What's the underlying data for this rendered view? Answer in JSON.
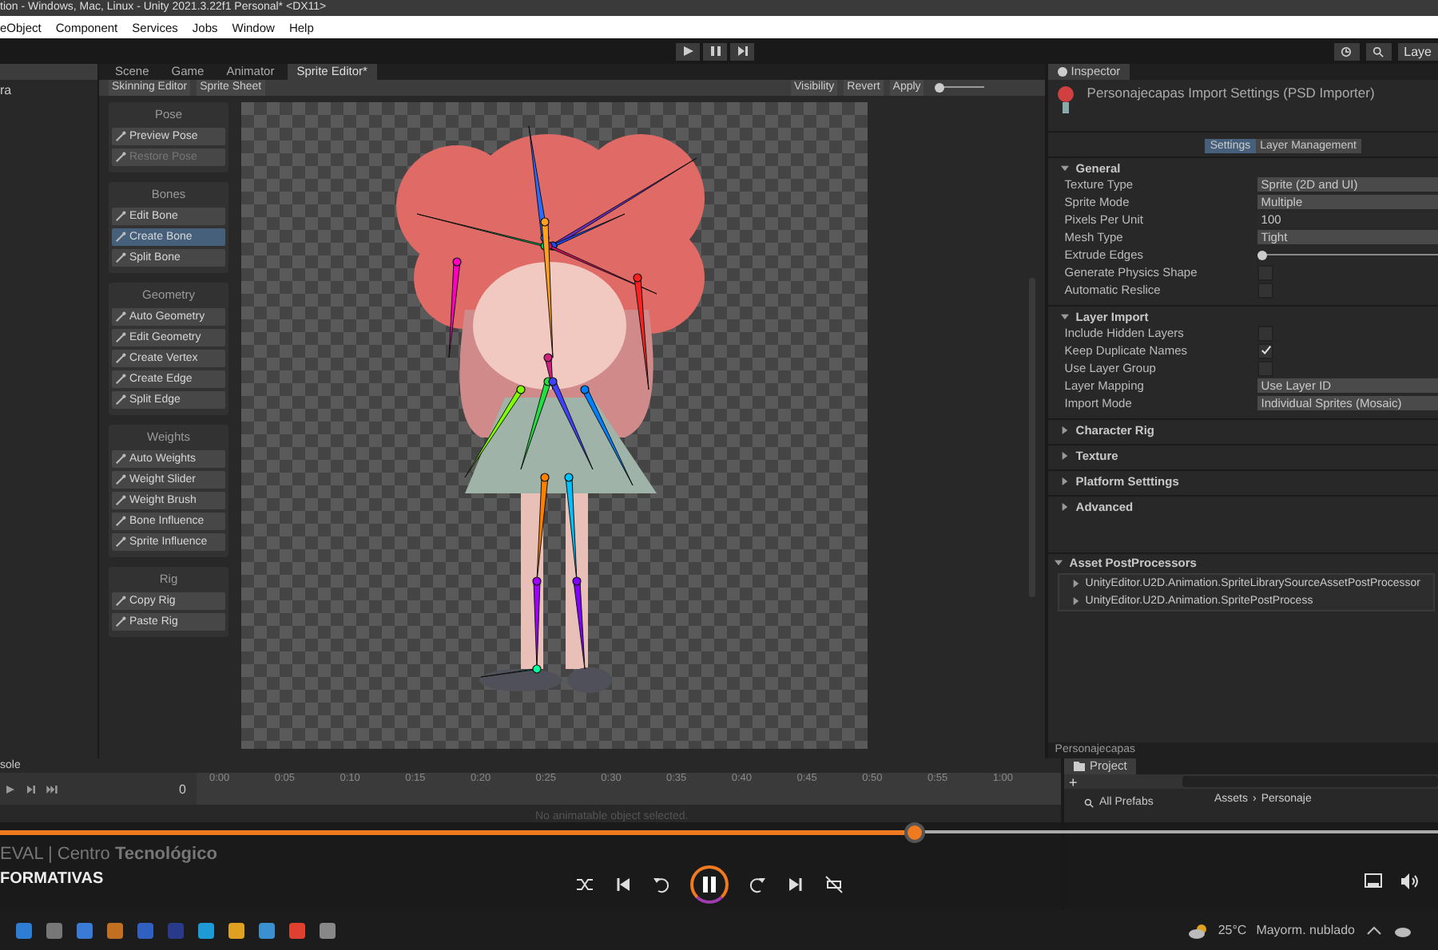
{
  "window": {
    "title": "tion - Windows, Mac, Linux - Unity 2021.3.22f1 Personal* <DX11>"
  },
  "menu": [
    "eObject",
    "Component",
    "Services",
    "Jobs",
    "Window",
    "Help"
  ],
  "toolbar": {
    "layers_label": "Laye"
  },
  "hierarchy": {
    "items": [
      {
        "label": "ra",
        "selected": false
      }
    ]
  },
  "editor_tabs": [
    {
      "label": "Scene",
      "selected": false
    },
    {
      "label": "Game",
      "selected": false
    },
    {
      "label": "Animator",
      "selected": false
    },
    {
      "label": "Sprite Editor*",
      "selected": true
    }
  ],
  "sprite_toolbar": {
    "mode": "Skinning Editor",
    "sheet": "Sprite Sheet",
    "buttons": [
      "Visibility",
      "Revert",
      "Apply"
    ],
    "zoom": {
      "level": 0.05
    }
  },
  "tool_groups": [
    {
      "title": "Pose",
      "tools": [
        {
          "label": "Preview Pose",
          "selected": false,
          "disabled": false
        },
        {
          "label": "Restore Pose",
          "selected": false,
          "disabled": true
        }
      ]
    },
    {
      "title": "Bones",
      "tools": [
        {
          "label": "Edit Bone",
          "selected": false,
          "disabled": false
        },
        {
          "label": "Create Bone",
          "selected": true,
          "disabled": false
        },
        {
          "label": "Split Bone",
          "selected": false,
          "disabled": false
        }
      ]
    },
    {
      "title": "Geometry",
      "tools": [
        {
          "label": "Auto Geometry",
          "selected": false,
          "disabled": false
        },
        {
          "label": "Edit Geometry",
          "selected": false,
          "disabled": false
        },
        {
          "label": "Create Vertex",
          "selected": false,
          "disabled": false
        },
        {
          "label": "Create Edge",
          "selected": false,
          "disabled": false
        },
        {
          "label": "Split Edge",
          "selected": false,
          "disabled": false
        }
      ]
    },
    {
      "title": "Weights",
      "tools": [
        {
          "label": "Auto Weights",
          "selected": false,
          "disabled": false
        },
        {
          "label": "Weight Slider",
          "selected": false,
          "disabled": false
        },
        {
          "label": "Weight Brush",
          "selected": false,
          "disabled": false
        },
        {
          "label": "Bone Influence",
          "selected": false,
          "disabled": false
        },
        {
          "label": "Sprite Influence",
          "selected": false,
          "disabled": false
        }
      ]
    },
    {
      "title": "Rig",
      "tools": [
        {
          "label": "Copy Rig",
          "selected": false,
          "disabled": false
        },
        {
          "label": "Paste Rig",
          "selected": false,
          "disabled": false
        }
      ]
    }
  ],
  "inspector": {
    "tab": "Inspector",
    "title": "Personajecapas Import Settings (PSD Importer)",
    "tabs": [
      {
        "label": "Settings",
        "selected": true
      },
      {
        "label": "Layer Management",
        "selected": false
      }
    ],
    "sections": [
      {
        "title": "General",
        "expanded": true,
        "fields": [
          {
            "kind": "dropdown",
            "label": "Texture Type",
            "value": "Sprite (2D and UI)"
          },
          {
            "kind": "dropdown",
            "label": "Sprite Mode",
            "value": "Multiple"
          },
          {
            "kind": "text",
            "label": "Pixels Per Unit",
            "value": "100"
          },
          {
            "kind": "dropdown",
            "label": "Mesh Type",
            "value": "Tight"
          },
          {
            "kind": "slider",
            "label": "Extrude Edges",
            "level": 0.02
          },
          {
            "kind": "checkbox",
            "label": "Generate Physics Shape",
            "checked": false
          },
          {
            "kind": "checkbox",
            "label": "Automatic Reslice",
            "checked": false
          }
        ]
      },
      {
        "title": "Layer Import",
        "expanded": true,
        "fields": [
          {
            "kind": "checkbox",
            "label": "Include Hidden Layers",
            "checked": false
          },
          {
            "kind": "checkbox",
            "label": "Keep Duplicate Names",
            "checked": true
          },
          {
            "kind": "checkbox",
            "label": "Use Layer Group",
            "checked": false
          },
          {
            "kind": "dropdown",
            "label": "Layer Mapping",
            "value": "Use Layer ID"
          },
          {
            "kind": "dropdown",
            "label": "Import Mode",
            "value": "Individual Sprites (Mosaic)"
          }
        ]
      },
      {
        "title": "Character Rig",
        "expanded": false
      },
      {
        "title": "Texture",
        "expanded": false
      },
      {
        "title": "Platform Setttings",
        "expanded": false
      },
      {
        "title": "Advanced",
        "expanded": false
      }
    ],
    "post_processors": {
      "title": "Asset PostProcessors",
      "items": [
        "UnityEditor.U2D.Animation.SpriteLibrarySourceAssetPostProcessor",
        "UnityEditor.U2D.Animation.SpritePostProcess"
      ]
    },
    "footer": "Personajecapas"
  },
  "animation": {
    "tab": "sole",
    "frame": "0",
    "message": "No animatable object selected.",
    "ticks": [
      "0:00",
      "0:05",
      "0:10",
      "0:15",
      "0:20",
      "0:25",
      "0:30",
      "0:35",
      "0:40",
      "0:45",
      "0:50",
      "0:55",
      "1:00"
    ]
  },
  "project": {
    "tab": "Project",
    "favorite": "All Prefabs",
    "breadcrumb": [
      "Assets",
      "Personaje"
    ],
    "add": "+",
    "separator": "›"
  },
  "video": {
    "progress": {
      "level": 0.635
    },
    "brand": "EVAL | Centro **Tecnológico**",
    "subtitle": "FORMATIVAS"
  },
  "taskbar": {
    "temperature": "25°C",
    "weather": "Mayorm. nublado"
  }
}
